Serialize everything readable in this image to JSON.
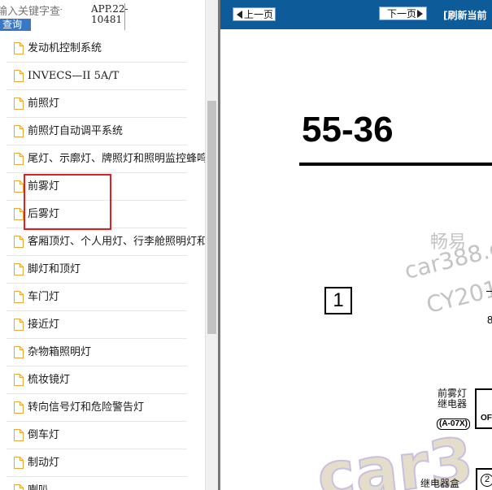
{
  "search": {
    "placeholder": "输入关键字查询",
    "button_label": "查询",
    "app_id": "APP.22-\n10481"
  },
  "toc_items": [
    {
      "label": "发动机控制系统"
    },
    {
      "label": "INVECS—II 5A/T"
    },
    {
      "label": "前照灯"
    },
    {
      "label": "前照灯自动调平系统"
    },
    {
      "label": "尾灯、示廓灯、牌照灯和照明监控蜂鸣器"
    },
    {
      "label": "前雾灯"
    },
    {
      "label": "后雾灯"
    },
    {
      "label": "客厢顶灯、个人用灯、行李舱照明灯和"
    },
    {
      "label": "脚灯和顶灯"
    },
    {
      "label": "车门灯"
    },
    {
      "label": "接近灯"
    },
    {
      "label": "杂物箱照明灯"
    },
    {
      "label": "梳妆镜灯"
    },
    {
      "label": "转向信号灯和危险警告灯"
    },
    {
      "label": "倒车灯"
    },
    {
      "label": "制动灯"
    },
    {
      "label": "喇叭"
    }
  ],
  "viewer": {
    "prev_label": "上一页",
    "next_label": "下一页",
    "refresh_label": "[刷新当前",
    "page_number": "55-36",
    "box_one": "1",
    "edge_digit": "8",
    "relay_label": "前雾灯\n继电器",
    "relay_code": "(A-07X)",
    "relay_off": "OFF",
    "circle_two": "2",
    "junction_label": "继电器盒"
  },
  "watermark": {
    "brand": "畅易",
    "url": "car388.c",
    "code": "CY201",
    "logo": "car3"
  },
  "colors": {
    "nav_bar": "#0d5b98",
    "search_button": "#3a78c6",
    "highlight": "#e02020"
  }
}
